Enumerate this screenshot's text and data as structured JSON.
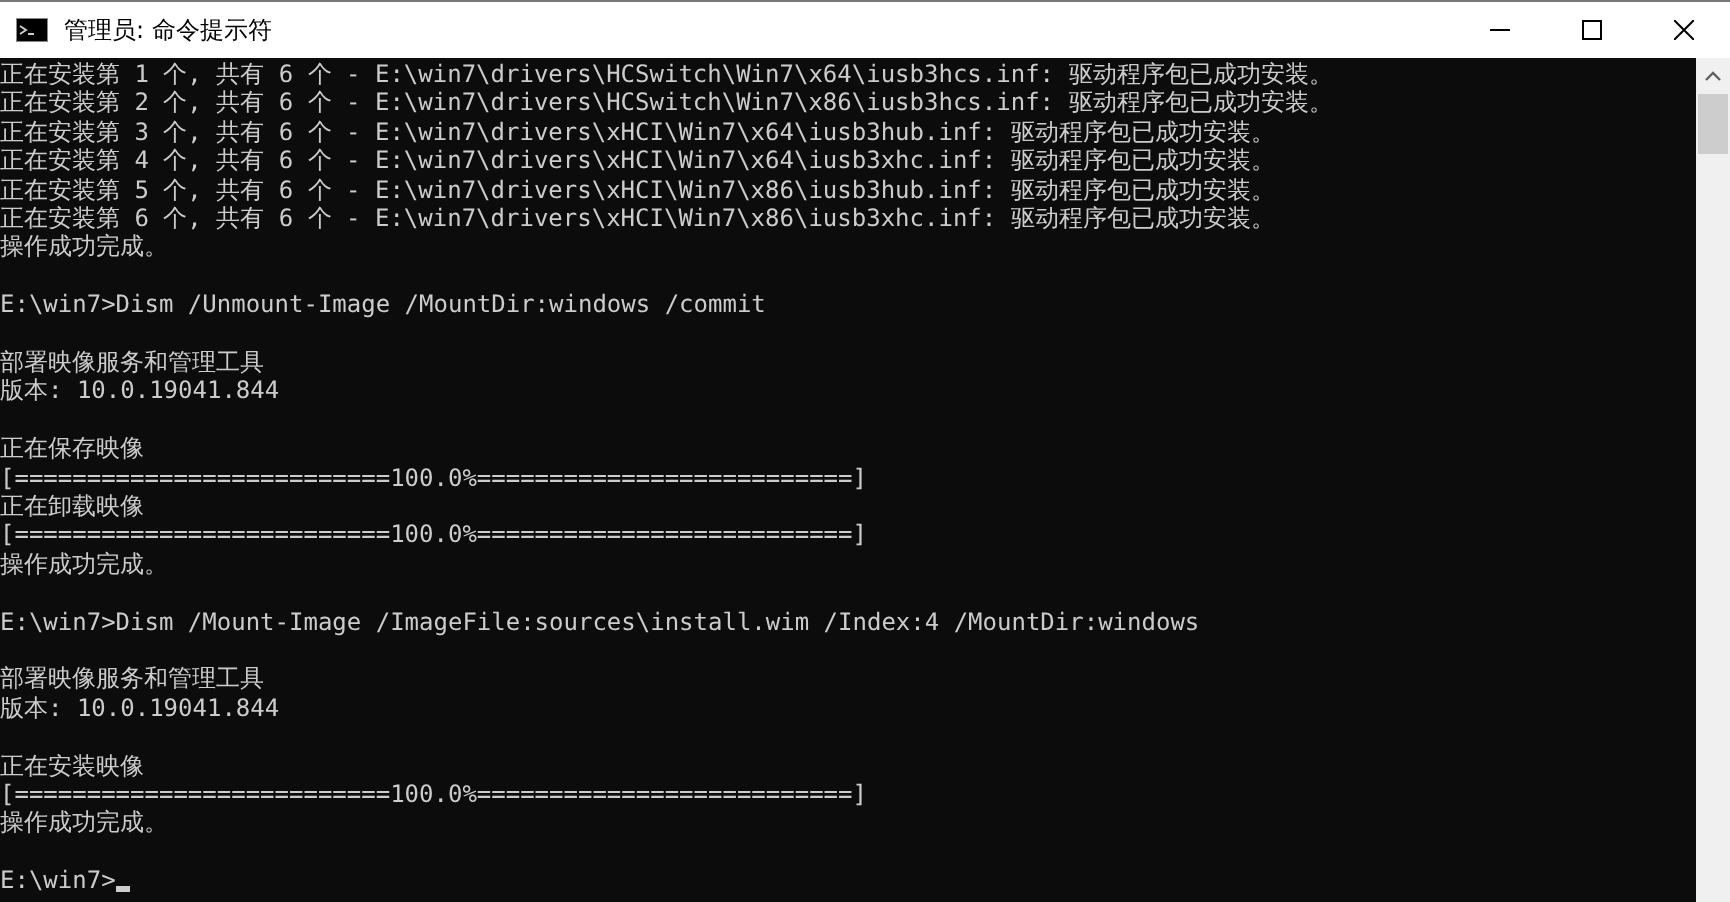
{
  "window": {
    "title": "管理员: 命令提示符"
  },
  "console": {
    "blocks": [
      [
        "正在安装第 1 个, 共有 6 个 - E:\\win7\\drivers\\HCSwitch\\Win7\\x64\\iusb3hcs.inf: 驱动程序包已成功安装。",
        "正在安装第 2 个, 共有 6 个 - E:\\win7\\drivers\\HCSwitch\\Win7\\x86\\iusb3hcs.inf: 驱动程序包已成功安装。",
        "正在安装第 3 个, 共有 6 个 - E:\\win7\\drivers\\xHCI\\Win7\\x64\\iusb3hub.inf: 驱动程序包已成功安装。",
        "正在安装第 4 个, 共有 6 个 - E:\\win7\\drivers\\xHCI\\Win7\\x64\\iusb3xhc.inf: 驱动程序包已成功安装。",
        "正在安装第 5 个, 共有 6 个 - E:\\win7\\drivers\\xHCI\\Win7\\x86\\iusb3hub.inf: 驱动程序包已成功安装。",
        "正在安装第 6 个, 共有 6 个 - E:\\win7\\drivers\\xHCI\\Win7\\x86\\iusb3xhc.inf: 驱动程序包已成功安装。",
        "操作成功完成。"
      ],
      [
        "E:\\win7>Dism /Unmount-Image /MountDir:windows /commit"
      ],
      [
        "部署映像服务和管理工具",
        "版本: 10.0.19041.844"
      ],
      [
        "正在保存映像",
        "[==========================100.0%==========================]",
        "正在卸载映像",
        "[==========================100.0%==========================]",
        "操作成功完成。"
      ],
      [
        "E:\\win7>Dism /Mount-Image /ImageFile:sources\\install.wim /Index:4 /MountDir:windows"
      ],
      [
        "部署映像服务和管理工具",
        "版本: 10.0.19041.844"
      ],
      [
        "正在安装映像",
        "[==========================100.0%==========================]",
        "操作成功完成。"
      ],
      [
        "E:\\win7>"
      ]
    ]
  }
}
